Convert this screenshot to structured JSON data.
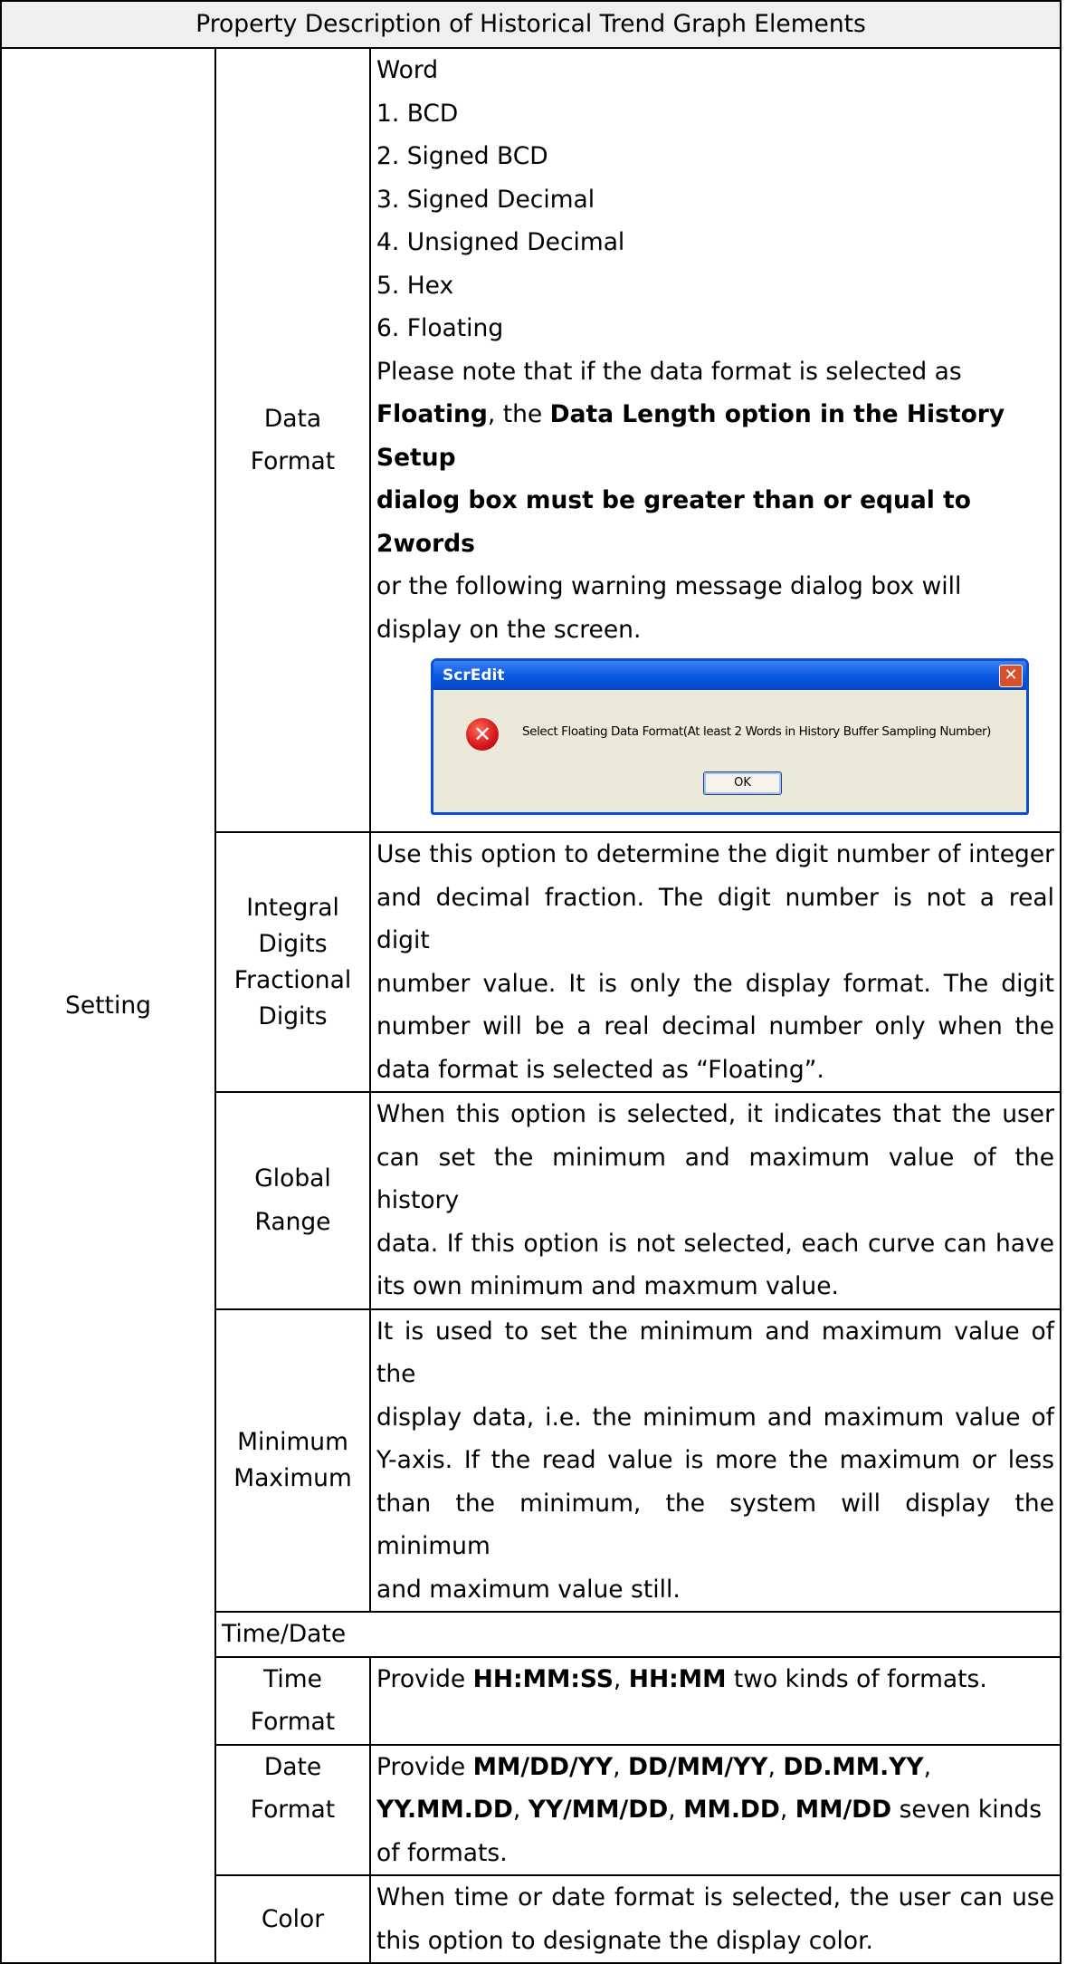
{
  "title": "Property Description of Historical Trend Graph Elements",
  "category": "Setting",
  "data_format": {
    "label_line1": "Data",
    "label_line2": "Format",
    "word": "Word",
    "options": [
      "1.  BCD",
      "2.  Signed BCD",
      "3.  Signed Decimal",
      "4.  Unsigned Decimal",
      "5.  Hex",
      "6.  Floating"
    ],
    "note_1": "Please note that if the data format is selected as",
    "note_bold_1": "Floating",
    "note_2": ", the ",
    "note_bold_2": "Data Length option in the History Setup",
    "note_bold_3": "dialog box must be greater than or equal to 2words",
    "note_3": "or the following warning message dialog box will",
    "note_4": "display on the screen.",
    "dialog": {
      "title": "ScrEdit",
      "message": "Select Floating Data Format(At least 2 Words in History Buffer Sampling Number)",
      "ok_label": "OK",
      "close_glyph": "✕",
      "icon_glyph": "✕"
    }
  },
  "digits": {
    "label_line1": "Integral",
    "label_line2": "Digits",
    "label_line3": "Fractional",
    "label_line4": "Digits",
    "lines": [
      "Use this option to determine the digit number of integer",
      "and decimal fraction. The digit number is not a real digit",
      "number value. It is only the display format. The digit",
      "number will be a real decimal number only when the",
      "data format is selected as “Floating”."
    ]
  },
  "global_range": {
    "label_line1": "Global",
    "label_line2": "Range",
    "lines": [
      "When this option is selected, it indicates that the user",
      "can set the minimum and maximum value of the history",
      "data. If this option is not selected, each curve can have",
      "its own minimum and maxmum value."
    ]
  },
  "min_max": {
    "label_line1": "Minimum",
    "label_line2": "Maximum",
    "lines": [
      "It is used to set the minimum and maximum value of the",
      "display data, i.e. the minimum and maximum value of",
      "Y-axis. If the read value is more the maximum or less",
      "than the minimum, the system will display the minimum",
      "and maximum value still."
    ]
  },
  "time_date": "Time/Date",
  "time_format": {
    "label_line1": "Time",
    "label_line2": "Format",
    "text_1": "Provide ",
    "bold_1": "HH:MM:SS",
    "text_2": ", ",
    "bold_2": "HH:MM",
    "text_3": " two kinds of formats."
  },
  "date_format": {
    "label_line1": "Date",
    "label_line2": "Format",
    "l1_text_1": "Provide ",
    "l1_bold_1": "MM/DD/YY",
    "l1_text_2": ", ",
    "l1_bold_2": "DD/MM/YY",
    "l1_text_3": ", ",
    "l1_bold_3": "DD.MM.YY",
    "l1_text_4": ",",
    "l2_bold_1": "YY.MM.DD",
    "l2_text_1": ", ",
    "l2_bold_2": "YY/MM/DD",
    "l2_text_2": ", ",
    "l2_bold_3": "MM.DD",
    "l2_text_3": ", ",
    "l2_bold_4": "MM/DD",
    "l2_text_4": " seven kinds",
    "l3_text": "of formats."
  },
  "color": {
    "label": "Color",
    "lines": [
      "When time or date format is selected, the user can use",
      "this option to designate the display color."
    ]
  }
}
